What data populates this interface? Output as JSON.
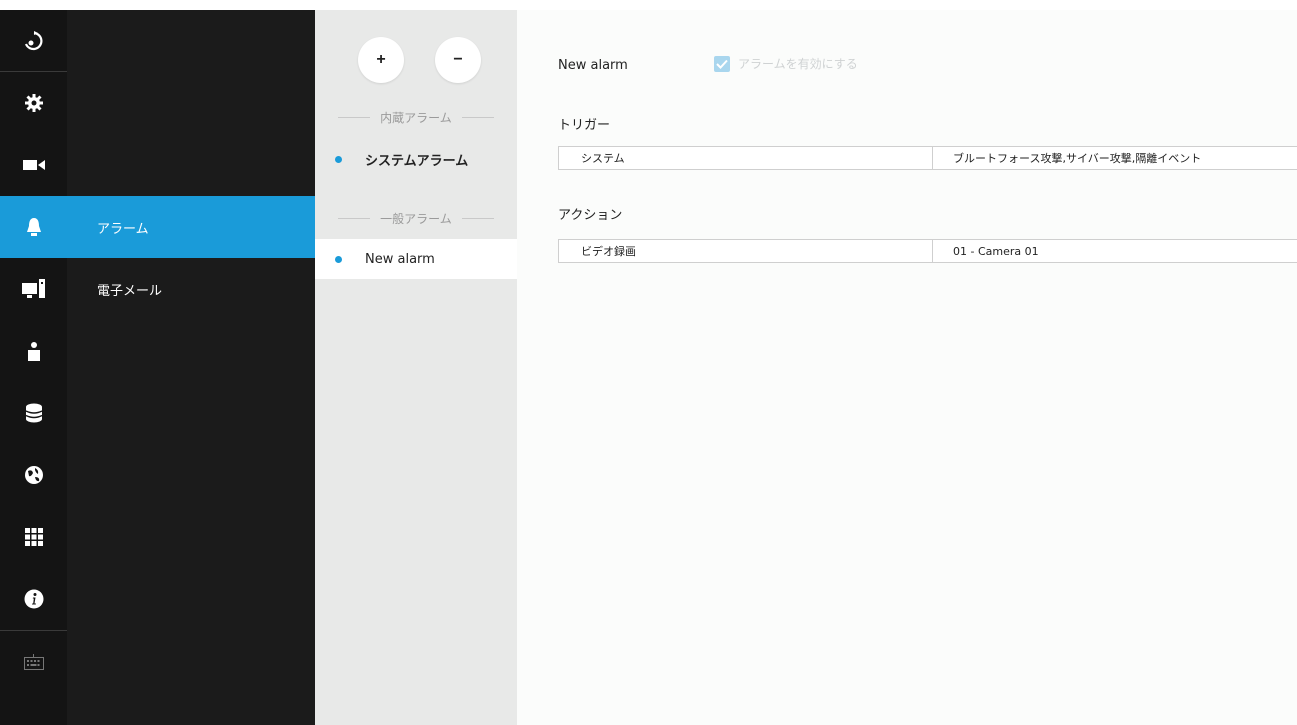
{
  "rail": {
    "items": [
      {
        "icon": "logo-icon"
      },
      {
        "icon": "gear-icon"
      },
      {
        "icon": "camera-icon"
      },
      {
        "icon": "bell-icon",
        "active": true
      },
      {
        "icon": "monitor-icon"
      },
      {
        "icon": "user-icon"
      },
      {
        "icon": "database-icon"
      },
      {
        "icon": "globe-icon"
      },
      {
        "icon": "grid-icon"
      },
      {
        "icon": "info-icon"
      },
      {
        "icon": "keyboard-icon"
      }
    ],
    "accent_color": "#1a9bd9"
  },
  "submenu": {
    "items": [
      {
        "label": "アラーム",
        "active": true
      },
      {
        "label": "電子メール"
      }
    ]
  },
  "alarm_list": {
    "add_label": "+",
    "remove_label": "−",
    "builtin_header": "内蔵アラーム",
    "builtin_items": [
      {
        "label": "システムアラーム"
      }
    ],
    "general_header": "一般アラーム",
    "general_items": [
      {
        "label": "New alarm",
        "selected": true
      }
    ]
  },
  "detail": {
    "alarm_name": "New alarm",
    "enable_label": "アラームを有効にする",
    "enable_checked": true,
    "trigger_title": "トリガー",
    "trigger_row": {
      "type": "システム",
      "value": "ブルートフォース攻撃,サイバー攻撃,隔離イベント"
    },
    "action_title": "アクション",
    "action_row": {
      "type": "ビデオ録画",
      "value": "01 - Camera 01"
    }
  }
}
